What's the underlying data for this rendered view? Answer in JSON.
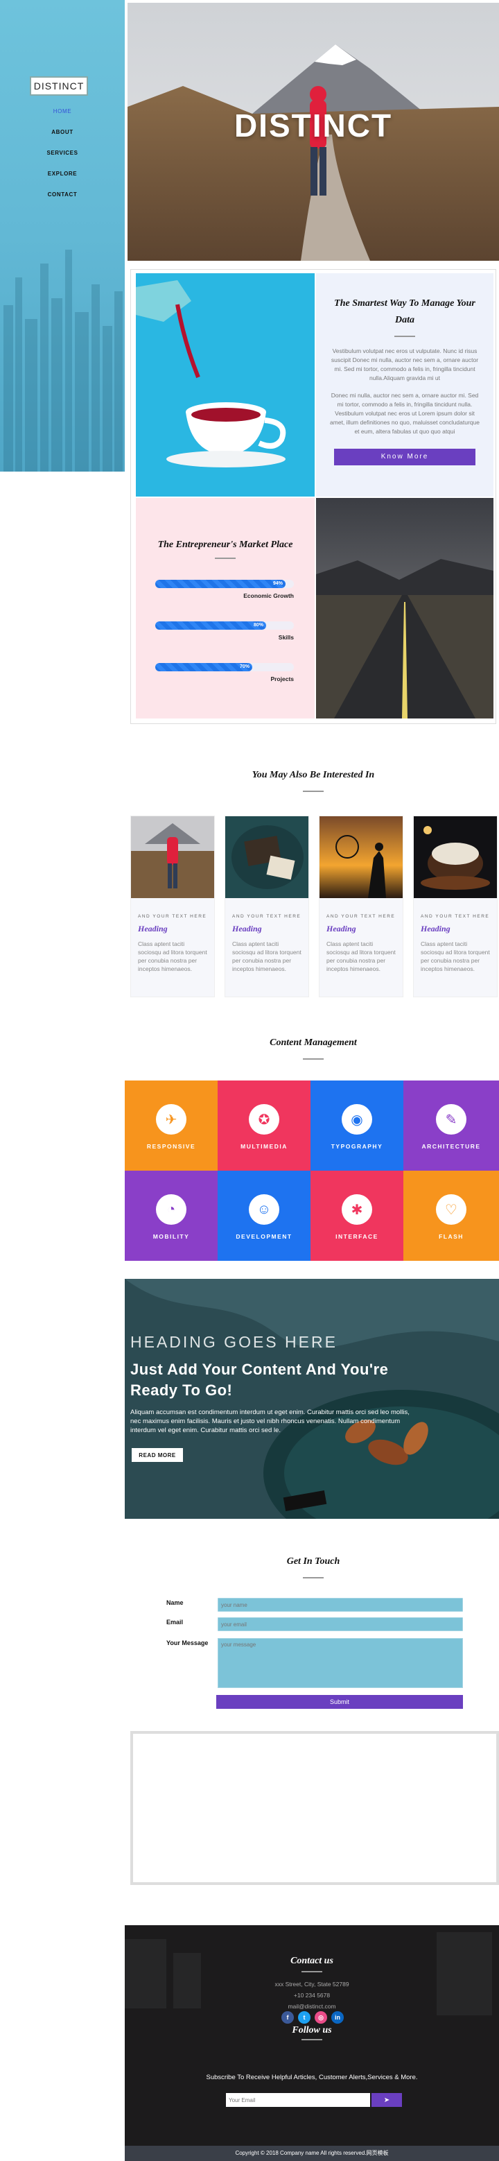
{
  "sidebar": {
    "logo": "DISTINCT",
    "nav": [
      "HOME",
      "ABOUT",
      "SERVICES",
      "EXPLORE",
      "CONTACT"
    ]
  },
  "hero": {
    "title": "DISTINCT"
  },
  "about": {
    "title": "The Smartest Way To Manage Your Data",
    "para1": "Vestibulum volutpat nec eros ut vulputate. Nunc id risus suscipit Donec mi nulla, auctor nec sem a, ornare auctor mi. Sed mi tortor, commodo a felis in, fringilla tincidunt nulla.Aliquam gravida mi ut",
    "para2": "Donec mi nulla, auctor nec sem a, ornare auctor mi. Sed mi tortor, commodo a felis in, fringilla tincidunt nulla. Vestibulum volutpat nec eros ut Lorem ipsum dolor sit amet, illum definitiones no quo, maluisset concludaturque et eum, altera fabulas ut quo quo atqui",
    "button": "Know More"
  },
  "market": {
    "title": "The Entrepreneur's Market Place",
    "skills": [
      {
        "label": "Economic Growth",
        "pct_label": "94%",
        "value": 0.94
      },
      {
        "label": "Skills",
        "pct_label": "80%",
        "value": 0.8
      },
      {
        "label": "Projects",
        "pct_label": "70%",
        "value": 0.7
      }
    ]
  },
  "interested": {
    "title": "You May Also Be Interested In",
    "cards": [
      {
        "tag": "AND YOUR TEXT HERE",
        "heading": "Heading",
        "text": "Class aptent taciti sociosqu ad litora torquent per conubia nostra per inceptos himenaeos."
      },
      {
        "tag": "AND YOUR TEXT HERE",
        "heading": "Heading",
        "text": "Class aptent taciti sociosqu ad litora torquent per conubia nostra per inceptos himenaeos."
      },
      {
        "tag": "AND YOUR TEXT HERE",
        "heading": "Heading",
        "text": "Class aptent taciti sociosqu ad litora torquent per conubia nostra per inceptos himenaeos."
      },
      {
        "tag": "AND YOUR TEXT HERE",
        "heading": "Heading",
        "text": "Class aptent taciti sociosqu ad litora torquent per conubia nostra per inceptos himenaeos."
      }
    ]
  },
  "content": {
    "title": "Content Management",
    "tiles": [
      {
        "label": "RESPONSIVE",
        "icon": "rocket-icon",
        "glyph": "✈",
        "color": "#f7941d"
      },
      {
        "label": "MULTIMEDIA",
        "icon": "compass-icon",
        "glyph": "✪",
        "color": "#f0365e"
      },
      {
        "label": "TYPOGRAPHY",
        "icon": "globe-icon",
        "glyph": "◉",
        "color": "#1e73f0"
      },
      {
        "label": "ARCHITECTURE",
        "icon": "magic-icon",
        "glyph": "✎",
        "color": "#8a3fc8"
      },
      {
        "label": "MOBILITY",
        "icon": "chart-icon",
        "glyph": "◔",
        "color": "#8a3fc8"
      },
      {
        "label": "DEVELOPMENT",
        "icon": "code-icon",
        "glyph": "☺",
        "color": "#1e73f0"
      },
      {
        "label": "INTERFACE",
        "icon": "lightbulb-icon",
        "glyph": "✱",
        "color": "#f0365e"
      },
      {
        "label": "FLASH",
        "icon": "heart-icon",
        "glyph": "♡",
        "color": "#f7941d"
      }
    ]
  },
  "banner": {
    "small": "HEADING GOES HERE",
    "big": "Just Add Your Content And You're Ready To Go!",
    "desc": "Aliquam accumsan est condimentum interdum ut eget enim. Curabitur mattis orci sed leo mollis, nec maximus enim facilisis. Mauris et justo vel nibh rhoncus venenatis. Nullam condimentum interdum vel eget enim. Curabitur mattis orci sed le.",
    "button": "READ MORE"
  },
  "contact_form": {
    "title": "Get In Touch",
    "name_label": "Name",
    "name_placeholder": "your name",
    "email_label": "Email",
    "email_placeholder": "your email",
    "message_label": "Your Message",
    "message_placeholder": "your message",
    "submit": "Submit"
  },
  "footer": {
    "contact_title": "Contact us",
    "address": "xxx Street, City, State 52789",
    "phone": "+10 234 5678",
    "email": "mail@distinct.com",
    "follow_title": "Follow us",
    "social": [
      {
        "icon": "facebook-icon",
        "glyph": "f",
        "color": "#3b5998"
      },
      {
        "icon": "twitter-icon",
        "glyph": "t",
        "color": "#1da1f2"
      },
      {
        "icon": "dribbble-icon",
        "glyph": "◎",
        "color": "#ea4c89"
      },
      {
        "icon": "linkedin-icon",
        "glyph": "in",
        "color": "#0a66c2"
      }
    ],
    "subscribe_text": "Subscribe To Receive Helpful Articles, Customer Alerts,Services & More.",
    "subscribe_placeholder": "Your Email",
    "copyright": "Copyright © 2018 Company name All rights reserved.网页模板"
  }
}
